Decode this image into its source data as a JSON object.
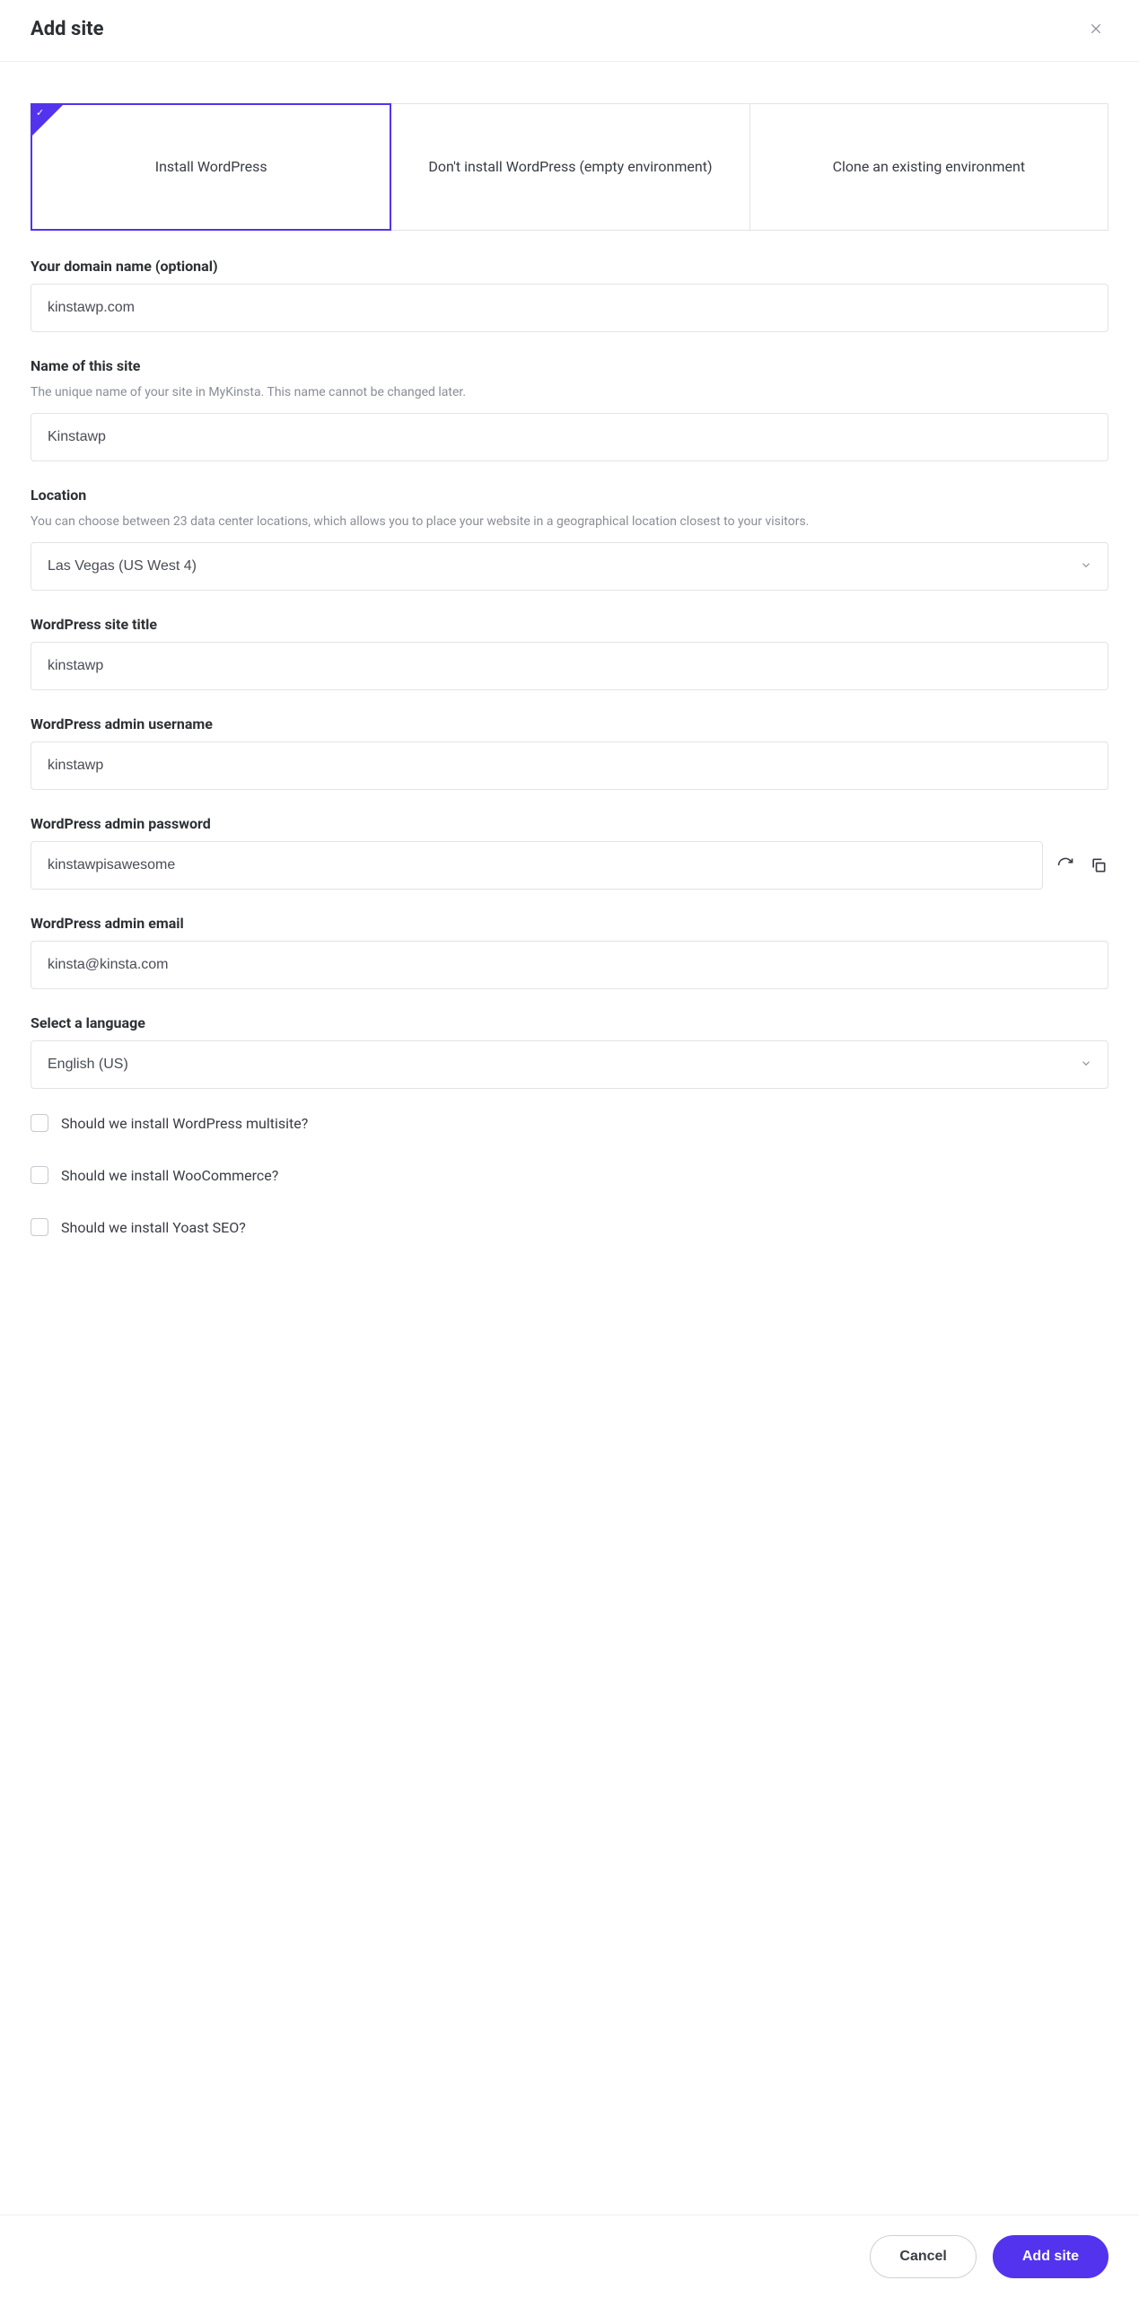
{
  "header": {
    "title": "Add site"
  },
  "options": {
    "install": {
      "label": "Install WordPress",
      "selected": true
    },
    "empty": {
      "label": "Don't install WordPress (empty environment)",
      "selected": false
    },
    "clone": {
      "label": "Clone an existing environment",
      "selected": false
    }
  },
  "fields": {
    "domain": {
      "label": "Your domain name (optional)",
      "value": "kinstawp.com"
    },
    "site_name": {
      "label": "Name of this site",
      "help": "The unique name of your site in MyKinsta. This name cannot be changed later.",
      "value": "Kinstawp"
    },
    "location": {
      "label": "Location",
      "help": "You can choose between 23 data center locations, which allows you to place your website in a geographical location closest to your visitors.",
      "value": "Las Vegas (US West 4)"
    },
    "wp_title": {
      "label": "WordPress site title",
      "value": "kinstawp"
    },
    "wp_user": {
      "label": "WordPress admin username",
      "value": "kinstawp"
    },
    "wp_pass": {
      "label": "WordPress admin password",
      "value": "kinstawpisawesome"
    },
    "wp_email": {
      "label": "WordPress admin email",
      "value": "kinsta@kinsta.com"
    },
    "language": {
      "label": "Select a language",
      "value": "English (US)"
    }
  },
  "checkboxes": {
    "multisite": {
      "label": "Should we install WordPress multisite?",
      "checked": false
    },
    "woocommerce": {
      "label": "Should we install WooCommerce?",
      "checked": false
    },
    "yoast": {
      "label": "Should we install Yoast SEO?",
      "checked": false
    }
  },
  "footer": {
    "cancel": "Cancel",
    "submit": "Add site"
  }
}
